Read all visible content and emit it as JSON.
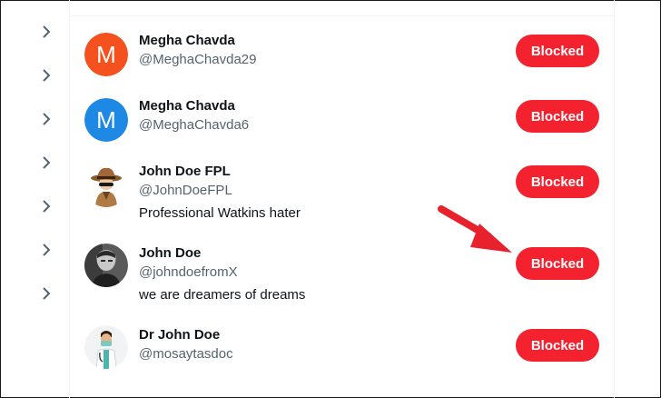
{
  "blocked_list": [
    {
      "name": "Megha Chavda",
      "handle": "@MeghaChavda29",
      "bio": "",
      "avatar_letter": "M",
      "avatar_color": "#f4511e",
      "button_label": "Blocked"
    },
    {
      "name": "Megha Chavda",
      "handle": "@MeghaChavda6",
      "bio": "",
      "avatar_letter": "M",
      "avatar_color": "#1e88e5",
      "button_label": "Blocked"
    },
    {
      "name": "John Doe FPL",
      "handle": "@JohnDoeFPL",
      "bio": "Professional Watkins hater",
      "avatar_icon": "spy-cartoon-avatar",
      "button_label": "Blocked"
    },
    {
      "name": "John Doe",
      "handle": "@johndoefromX",
      "bio": "we are dreamers of dreams",
      "avatar_icon": "bw-photo-avatar",
      "button_label": "Blocked"
    },
    {
      "name": "Dr John Doe",
      "handle": "@mosaytasdoc",
      "bio": "",
      "avatar_icon": "doctor-cartoon-avatar",
      "button_label": "Blocked"
    }
  ],
  "colors": {
    "blocked_button": "#f4212e",
    "annotation_arrow": "#e8222c",
    "handle_text": "#536471"
  },
  "icons": {
    "sidebar_chevron": "chevron-right-icon",
    "annotation": "red-arrow-icon"
  }
}
